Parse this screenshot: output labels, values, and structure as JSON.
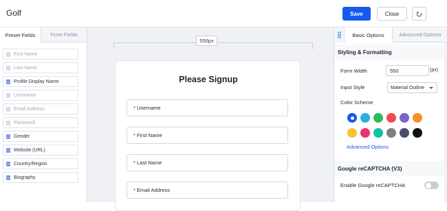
{
  "header": {
    "title": "Golf",
    "save_label": "Save",
    "close_label": "Close"
  },
  "left_panel": {
    "tabs": [
      "Preset Fields",
      "Form Fields"
    ],
    "fields": [
      {
        "label": "First Name",
        "enabled": false
      },
      {
        "label": "Last Name",
        "enabled": false
      },
      {
        "label": "Profile Display Name",
        "enabled": true
      },
      {
        "label": "Username",
        "enabled": false
      },
      {
        "label": "Email Address",
        "enabled": false
      },
      {
        "label": "Password",
        "enabled": false
      },
      {
        "label": "Gender",
        "enabled": true
      },
      {
        "label": "Website (URL)",
        "enabled": true
      },
      {
        "label": "Country/Region",
        "enabled": true
      },
      {
        "label": "Biography",
        "enabled": true
      }
    ]
  },
  "canvas": {
    "width_label": "550px",
    "form_title": "Please Signup",
    "inputs": [
      "* Username",
      "* First Name",
      "* Last Name",
      "* Email Address"
    ]
  },
  "right_panel": {
    "tabs": [
      "Basic Options",
      "Advanced Options"
    ],
    "styling_heading": "Styling & Formatting",
    "form_width_label": "Form Width",
    "form_width_value": "550",
    "form_width_unit": "(px)",
    "input_style_label": "Input Style",
    "input_style_value": "Material Outline",
    "color_scheme_label": "Color Scheme",
    "colors": [
      "#1559ed",
      "#29aee0",
      "#2fba58",
      "#f04a4a",
      "#7a64c4",
      "#f7901e",
      "#f7c531",
      "#e8346f",
      "#13c2a5",
      "#7d7f84",
      "#4a4d6b",
      "#111111"
    ],
    "selected_color": "#1559ed",
    "advanced_link": "Advanced Options",
    "recaptcha_heading": "Google reCAPTCHA (V3)",
    "recaptcha_label": "Enable Google reCAPTCHA",
    "recaptcha_enabled": false
  }
}
